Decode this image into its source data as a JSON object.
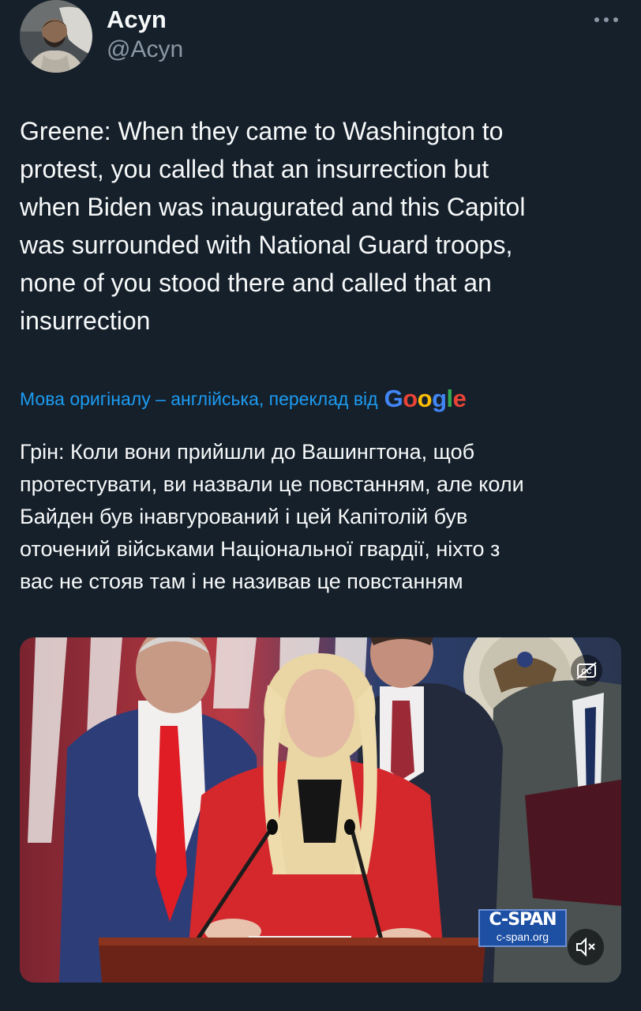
{
  "author": {
    "display_name": "Acyn",
    "handle": "@Acyn",
    "avatar_icon": "user-avatar"
  },
  "menu": {
    "icon": "more-horizontal-icon"
  },
  "tweet": {
    "text": "Greene: When they came to Washington to\nprotest, you called that an insurrection but\nwhen Biden was inaugurated and this Capitol\nwas surrounded with National Guard troops,\nnone of you stood there and called that an\ninsurrection"
  },
  "translation": {
    "label": "Мова оригіналу – англійська, переклад від",
    "provider": "Google",
    "provider_letters": [
      {
        "ch": "G",
        "color": "#4285f4"
      },
      {
        "ch": "o",
        "color": "#ea4335"
      },
      {
        "ch": "o",
        "color": "#fbbc05"
      },
      {
        "ch": "g",
        "color": "#4285f4"
      },
      {
        "ch": "l",
        "color": "#34a853"
      },
      {
        "ch": "e",
        "color": "#ea4335"
      }
    ],
    "text": "Грін: Коли вони прийшли до Вашингтона, щоб\nпротестувати, ви назвали це повстанням, але коли\nБайден був інавгурований і цей Капітолій був\nоточений військами Національної гвардії, ніхто з\nвас не стояв там і не називав це повстанням"
  },
  "video": {
    "watermark_name": "C-SPAN",
    "watermark_url": "c-span.org",
    "cc_icon": "captions-off-icon",
    "mute_icon": "volume-muted-icon"
  },
  "colors": {
    "background": "#15202b",
    "accent": "#1d9bf0",
    "text_primary": "#f7f9f9",
    "text_secondary": "#8b98a5"
  }
}
